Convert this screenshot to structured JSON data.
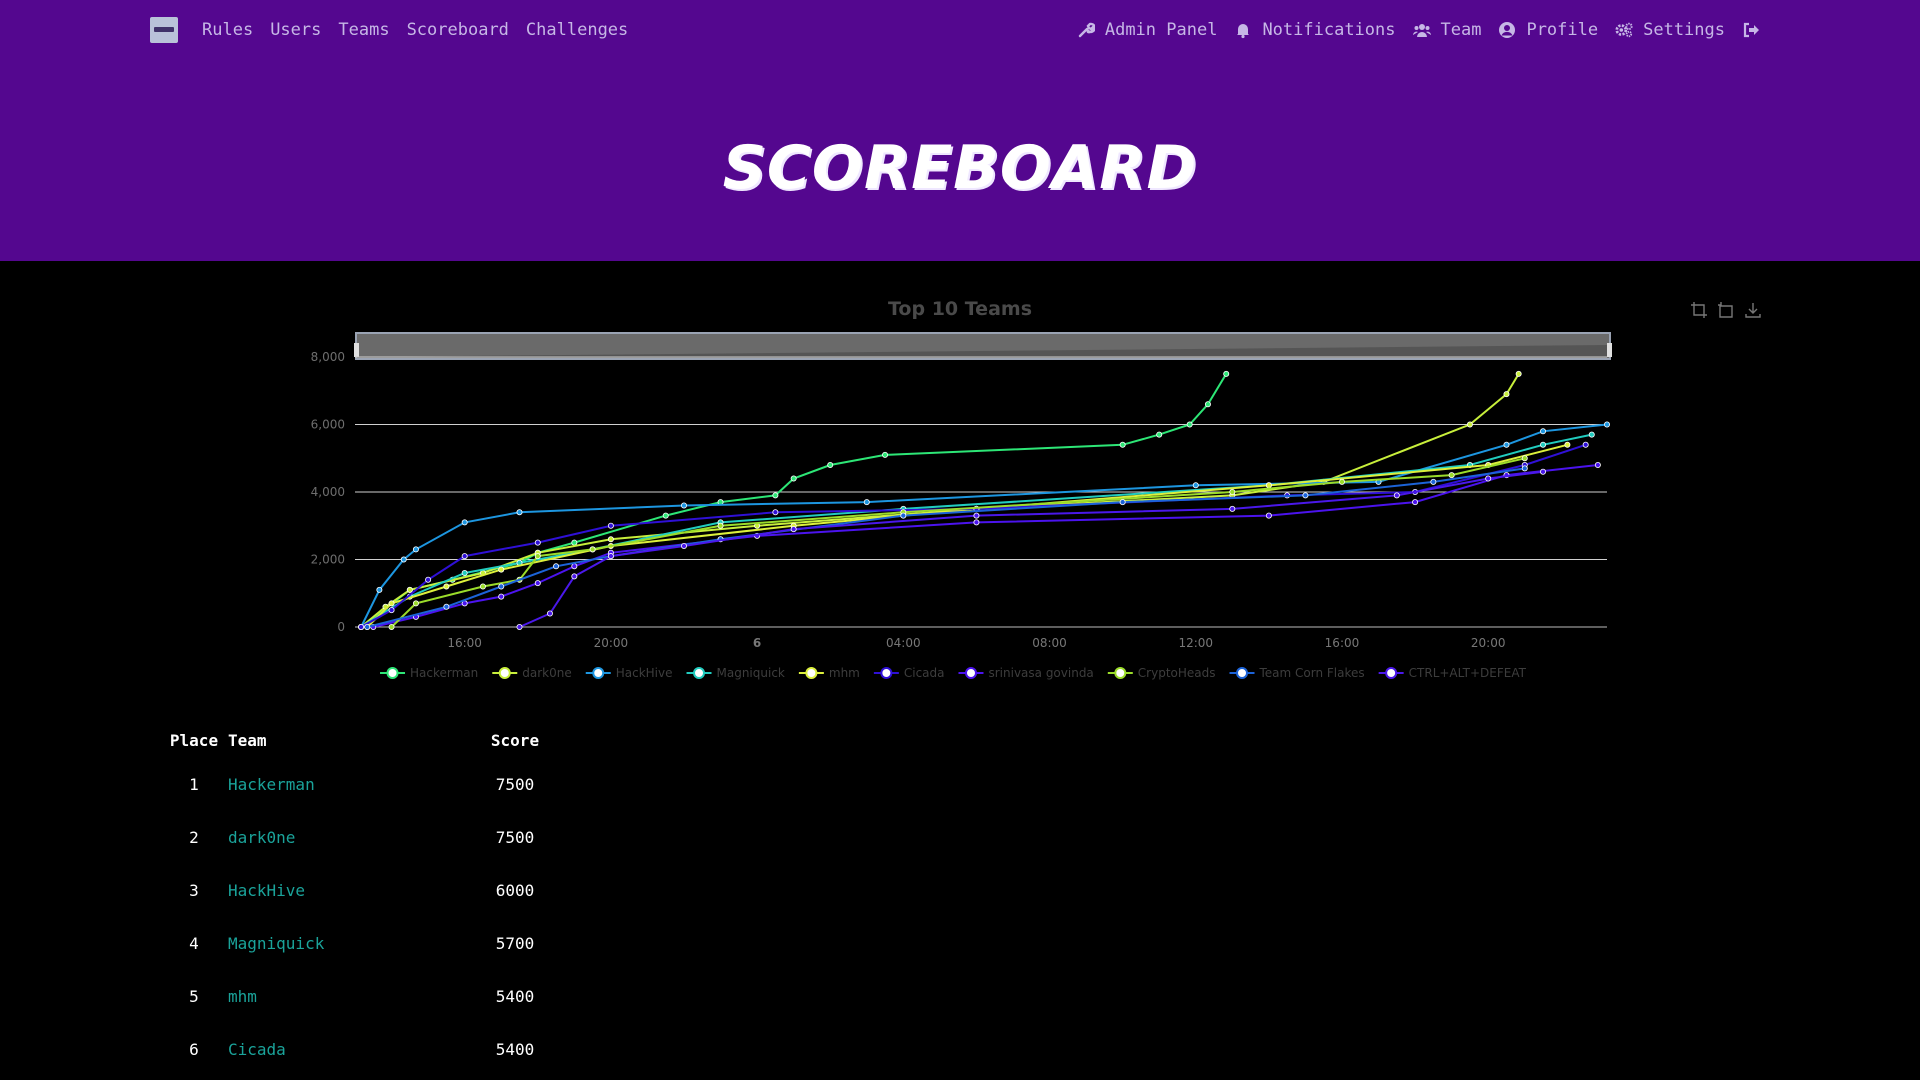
{
  "nav": {
    "left_items": [
      "Rules",
      "Users",
      "Teams",
      "Scoreboard",
      "Challenges"
    ],
    "admin_panel": "Admin Panel",
    "notifications": "Notifications",
    "team": "Team",
    "profile": "Profile",
    "settings": "Settings"
  },
  "page_title": "SCOREBOARD",
  "colors": {
    "navbar_bg": "#54078f",
    "team_link": "#1aa39a"
  },
  "chart_data": {
    "type": "line",
    "title": "Top 10 Teams",
    "x_tick_labels": [
      "16:00",
      "20:00",
      "6",
      "04:00",
      "08:00",
      "12:00",
      "16:00",
      "20:00"
    ],
    "x_range": [
      "2024-01-05T13:00",
      "2024-01-06T23:15"
    ],
    "ylim": [
      0,
      8000
    ],
    "y_ticks": [
      0,
      2000,
      4000,
      6000,
      8000
    ],
    "grid": true,
    "legend_placement": "bottom",
    "series": [
      {
        "name": "Hackerman",
        "color": "#2de676",
        "points": [
          [
            "2024-01-05T13:10",
            0
          ],
          [
            "2024-01-05T14:30",
            1100
          ],
          [
            "2024-01-05T15:40",
            1400
          ],
          [
            "2024-01-05T17:30",
            1900
          ],
          [
            "2024-01-05T18:00",
            2200
          ],
          [
            "2024-01-05T19:00",
            2500
          ],
          [
            "2024-01-05T21:30",
            3300
          ],
          [
            "2024-01-05T23:00",
            3700
          ],
          [
            "2024-01-06T00:30",
            3900
          ],
          [
            "2024-01-06T01:00",
            4400
          ],
          [
            "2024-01-06T02:00",
            4800
          ],
          [
            "2024-01-06T03:30",
            5100
          ],
          [
            "2024-01-06T10:00",
            5400
          ],
          [
            "2024-01-06T11:00",
            5700
          ],
          [
            "2024-01-06T11:50",
            6000
          ],
          [
            "2024-01-06T12:20",
            6600
          ],
          [
            "2024-01-06T12:50",
            7500
          ]
        ]
      },
      {
        "name": "dark0ne",
        "color": "#c8ef3b",
        "points": [
          [
            "2024-01-05T13:10",
            0
          ],
          [
            "2024-01-05T13:50",
            600
          ],
          [
            "2024-01-05T14:30",
            1100
          ],
          [
            "2024-01-05T16:30",
            1600
          ],
          [
            "2024-01-05T18:00",
            2200
          ],
          [
            "2024-01-05T20:00",
            2600
          ],
          [
            "2024-01-06T00:00",
            3000
          ],
          [
            "2024-01-06T06:00",
            3500
          ],
          [
            "2024-01-06T13:00",
            3900
          ],
          [
            "2024-01-06T15:30",
            4300
          ],
          [
            "2024-01-06T19:30",
            6000
          ],
          [
            "2024-01-06T20:30",
            6900
          ],
          [
            "2024-01-06T20:50",
            7500
          ]
        ]
      },
      {
        "name": "HackHive",
        "color": "#1d96e0",
        "points": [
          [
            "2024-01-05T13:10",
            0
          ],
          [
            "2024-01-05T13:40",
            1100
          ],
          [
            "2024-01-05T14:20",
            2000
          ],
          [
            "2024-01-05T14:40",
            2300
          ],
          [
            "2024-01-05T16:00",
            3100
          ],
          [
            "2024-01-05T17:30",
            3400
          ],
          [
            "2024-01-05T22:00",
            3600
          ],
          [
            "2024-01-06T03:00",
            3700
          ],
          [
            "2024-01-06T12:00",
            4200
          ],
          [
            "2024-01-06T17:00",
            4300
          ],
          [
            "2024-01-06T20:30",
            5400
          ],
          [
            "2024-01-06T21:30",
            5800
          ],
          [
            "2024-01-06T23:15",
            6000
          ]
        ]
      },
      {
        "name": "Magniquick",
        "color": "#21ccbf",
        "points": [
          [
            "2024-01-05T13:10",
            0
          ],
          [
            "2024-01-05T14:30",
            900
          ],
          [
            "2024-01-05T16:00",
            1600
          ],
          [
            "2024-01-05T17:30",
            1900
          ],
          [
            "2024-01-05T19:30",
            2300
          ],
          [
            "2024-01-05T23:00",
            3100
          ],
          [
            "2024-01-06T04:00",
            3500
          ],
          [
            "2024-01-06T14:00",
            4200
          ],
          [
            "2024-01-06T19:30",
            4800
          ],
          [
            "2024-01-06T21:30",
            5400
          ],
          [
            "2024-01-06T22:50",
            5700
          ]
        ]
      },
      {
        "name": "mhm",
        "color": "#dcf03c",
        "points": [
          [
            "2024-01-05T13:20",
            0
          ],
          [
            "2024-01-05T14:00",
            700
          ],
          [
            "2024-01-05T15:30",
            1200
          ],
          [
            "2024-01-05T17:00",
            1700
          ],
          [
            "2024-01-05T20:00",
            2400
          ],
          [
            "2024-01-06T01:00",
            3000
          ],
          [
            "2024-01-06T06:00",
            3500
          ],
          [
            "2024-01-06T14:00",
            4200
          ],
          [
            "2024-01-06T20:00",
            4800
          ],
          [
            "2024-01-06T22:10",
            5400
          ]
        ]
      },
      {
        "name": "Cicada",
        "color": "#2f10d6",
        "points": [
          [
            "2024-01-05T13:10",
            0
          ],
          [
            "2024-01-05T14:00",
            500
          ],
          [
            "2024-01-05T15:00",
            1400
          ],
          [
            "2024-01-05T16:00",
            2100
          ],
          [
            "2024-01-05T18:00",
            2500
          ],
          [
            "2024-01-05T20:00",
            3000
          ],
          [
            "2024-01-06T00:30",
            3400
          ],
          [
            "2024-01-06T06:00",
            3500
          ],
          [
            "2024-01-06T14:30",
            3900
          ],
          [
            "2024-01-06T18:00",
            4000
          ],
          [
            "2024-01-06T21:00",
            4800
          ],
          [
            "2024-01-06T22:40",
            5400
          ]
        ]
      },
      {
        "name": "srinivasa govinda",
        "color": "#4b13ee",
        "points": [
          [
            "2024-01-05T13:30",
            0
          ],
          [
            "2024-01-05T14:40",
            300
          ],
          [
            "2024-01-05T16:00",
            700
          ],
          [
            "2024-01-05T17:00",
            900
          ],
          [
            "2024-01-05T18:00",
            1300
          ],
          [
            "2024-01-05T19:00",
            1800
          ],
          [
            "2024-01-05T20:00",
            2200
          ],
          [
            "2024-01-06T00:00",
            2700
          ],
          [
            "2024-01-06T06:00",
            3100
          ],
          [
            "2024-01-06T14:00",
            3300
          ],
          [
            "2024-01-06T18:00",
            3700
          ],
          [
            "2024-01-06T20:30",
            4500
          ],
          [
            "2024-01-06T23:00",
            4800
          ]
        ]
      },
      {
        "name": "CryptoHeads",
        "color": "#9bdc2a",
        "points": [
          [
            "2024-01-05T14:00",
            0
          ],
          [
            "2024-01-05T14:40",
            700
          ],
          [
            "2024-01-05T16:30",
            1200
          ],
          [
            "2024-01-05T17:30",
            1400
          ],
          [
            "2024-01-05T18:00",
            2100
          ],
          [
            "2024-01-05T19:30",
            2300
          ],
          [
            "2024-01-05T23:00",
            3000
          ],
          [
            "2024-01-06T04:00",
            3400
          ],
          [
            "2024-01-06T13:00",
            4000
          ],
          [
            "2024-01-06T16:00",
            4300
          ],
          [
            "2024-01-06T19:00",
            4500
          ],
          [
            "2024-01-06T21:00",
            5000
          ]
        ]
      },
      {
        "name": "Team Corn Flakes",
        "color": "#1c63d8",
        "points": [
          [
            "2024-01-05T13:20",
            0
          ],
          [
            "2024-01-05T15:30",
            600
          ],
          [
            "2024-01-05T17:00",
            1200
          ],
          [
            "2024-01-05T18:30",
            1800
          ],
          [
            "2024-01-05T20:00",
            2100
          ],
          [
            "2024-01-05T23:00",
            2600
          ],
          [
            "2024-01-06T04:00",
            3300
          ],
          [
            "2024-01-06T10:00",
            3700
          ],
          [
            "2024-01-06T15:00",
            3900
          ],
          [
            "2024-01-06T18:30",
            4300
          ],
          [
            "2024-01-06T21:00",
            4700
          ]
        ]
      },
      {
        "name": "CTRL+ALT+DEFEAT",
        "color": "#4a18ea",
        "points": [
          [
            "2024-01-05T17:30",
            0
          ],
          [
            "2024-01-05T18:20",
            400
          ],
          [
            "2024-01-05T19:00",
            1500
          ],
          [
            "2024-01-05T20:00",
            2100
          ],
          [
            "2024-01-05T22:00",
            2400
          ],
          [
            "2024-01-06T01:00",
            2900
          ],
          [
            "2024-01-06T06:00",
            3300
          ],
          [
            "2024-01-06T13:00",
            3500
          ],
          [
            "2024-01-06T17:30",
            3900
          ],
          [
            "2024-01-06T20:00",
            4400
          ],
          [
            "2024-01-06T21:30",
            4600
          ]
        ]
      }
    ]
  },
  "table": {
    "headers": {
      "place": "Place",
      "team": "Team",
      "score": "Score"
    },
    "rows": [
      {
        "place": "1",
        "team": "Hackerman",
        "score": "7500"
      },
      {
        "place": "2",
        "team": "dark0ne",
        "score": "7500"
      },
      {
        "place": "3",
        "team": "HackHive",
        "score": "6000"
      },
      {
        "place": "4",
        "team": "Magniquick",
        "score": "5700"
      },
      {
        "place": "5",
        "team": "mhm",
        "score": "5400"
      },
      {
        "place": "6",
        "team": "Cicada",
        "score": "5400"
      }
    ]
  }
}
